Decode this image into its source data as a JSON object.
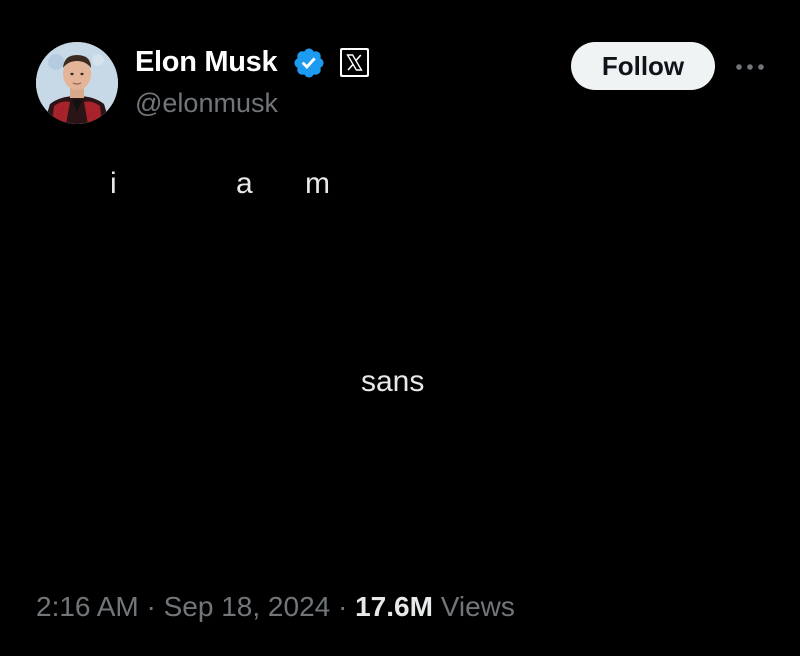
{
  "tweet": {
    "author": {
      "display_name": "Elon Musk",
      "handle": "@elonmusk",
      "verified_icon": "verified-badge-icon",
      "affiliate_icon": "x-logo-icon"
    },
    "actions": {
      "follow_label": "Follow",
      "more_icon": "more-dots-icon"
    },
    "text_words": [
      "i",
      "a",
      "m",
      "sans"
    ],
    "meta": {
      "time": "2:16 AM",
      "separator": "·",
      "date": "Sep 18, 2024",
      "views_count": "17.6M",
      "views_label": "Views"
    }
  },
  "colors": {
    "background": "#000000",
    "primary_text": "#e7e9ea",
    "secondary_text": "#71767b",
    "verified_blue": "#1d9bf0",
    "follow_bg": "#eff3f4"
  }
}
